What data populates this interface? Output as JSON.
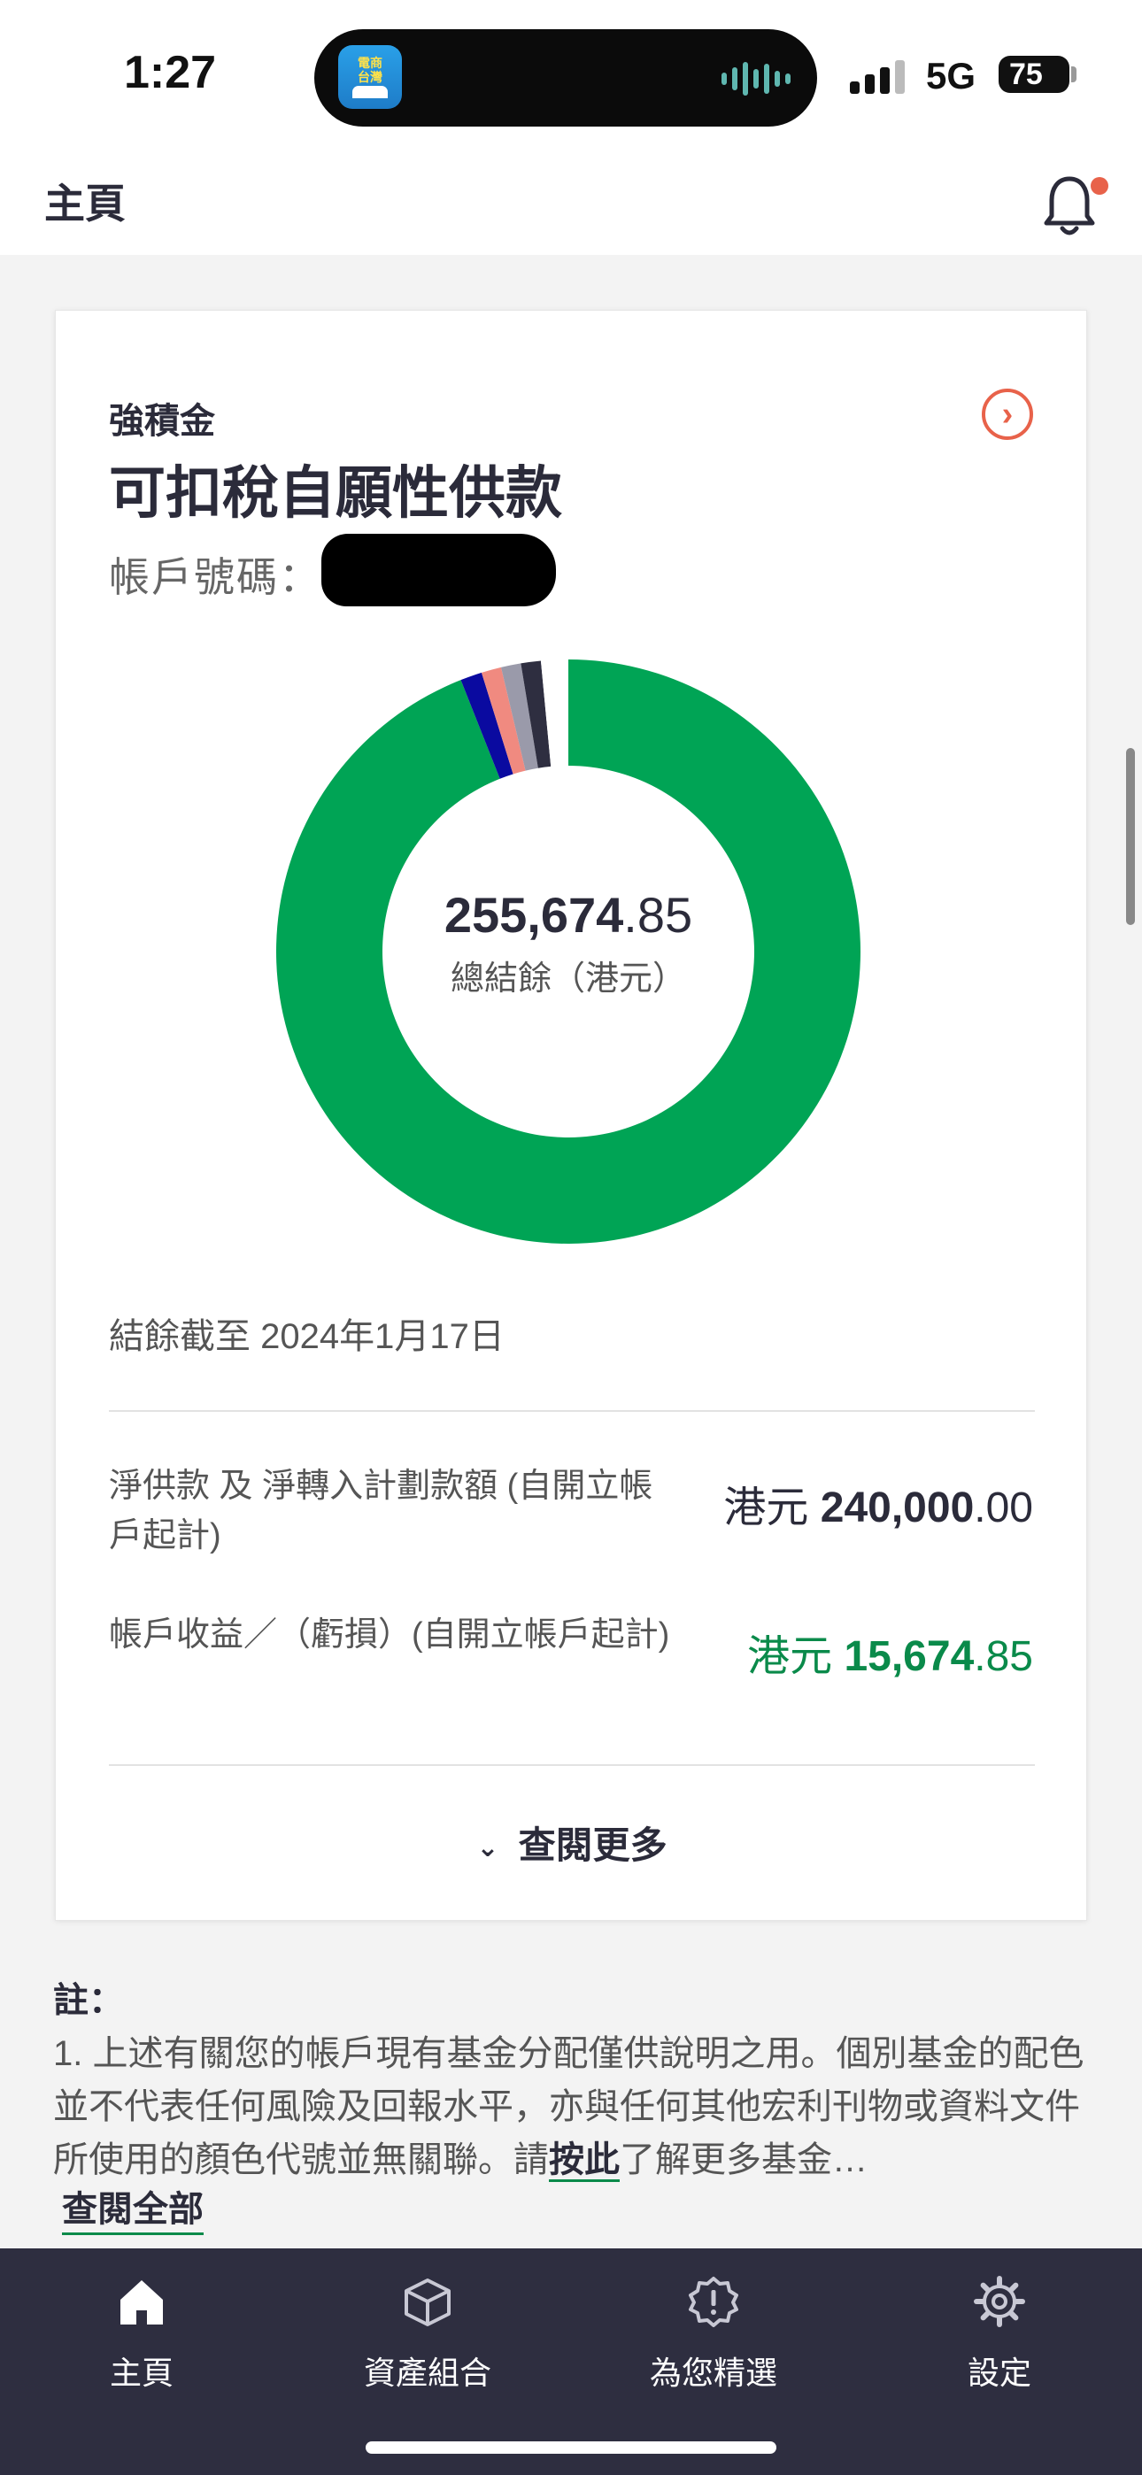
{
  "status_bar": {
    "time": "1:27",
    "island_app_text": "電商台灣",
    "network": "5G",
    "battery": "75"
  },
  "header": {
    "title": "主頁",
    "notification_icon": "bell-icon"
  },
  "card": {
    "kicker": "強積金",
    "title": "可扣稅自願性供款",
    "account_label": "帳戶號碼：",
    "total_int": "255,674",
    "total_dec": ".85",
    "total_label": "總結餘（港元）",
    "as_of": "結餘截至 2024年1月17日",
    "rows": [
      {
        "label": "淨供款 及 淨轉入計劃款額 (自開立帳戶起計)",
        "currency": "港元 ",
        "value_int": "240,000",
        "value_dec": ".00"
      },
      {
        "label": "帳戶收益／（虧損）(自開立帳戶起計)",
        "currency": "港元 ",
        "value_int": "15,674",
        "value_dec": ".85"
      }
    ],
    "view_more": "查閱更多"
  },
  "chart_data": {
    "type": "pie",
    "slices": [
      {
        "value": 94.0,
        "color": "#00a455"
      },
      {
        "value": 1.2,
        "color": "#0a0aa0"
      },
      {
        "value": 1.1,
        "color": "#f08a80"
      },
      {
        "value": 1.1,
        "color": "#9a9aaa"
      },
      {
        "value": 1.1,
        "color": "#2e2e40"
      },
      {
        "value": 1.5,
        "color": "#ffffff"
      }
    ],
    "start_angle_deg": 0
  },
  "notes": {
    "title": "註：",
    "text_before_link": "1.  上述有關您的帳戶現有基金分配僅供說明之用。個別基金的配色並不代表任何風險及回報水平，亦與任何其他宏利刊物或資料文件所使用的顏色代號並無關聯。請",
    "link": "按此",
    "text_after_link": "了解更多基金…",
    "view_all": "查閱全部"
  },
  "bottom_nav": {
    "items": [
      {
        "label": "主頁",
        "icon": "home-icon"
      },
      {
        "label": "資產組合",
        "icon": "box-icon"
      },
      {
        "label": "為您精選",
        "icon": "badge-alert-icon"
      },
      {
        "label": "設定",
        "icon": "gear-icon"
      }
    ]
  },
  "colors": {
    "accent_red": "#e8624a",
    "gain_green": "#0a8a4a",
    "nav_bg": "#2e2e40"
  }
}
